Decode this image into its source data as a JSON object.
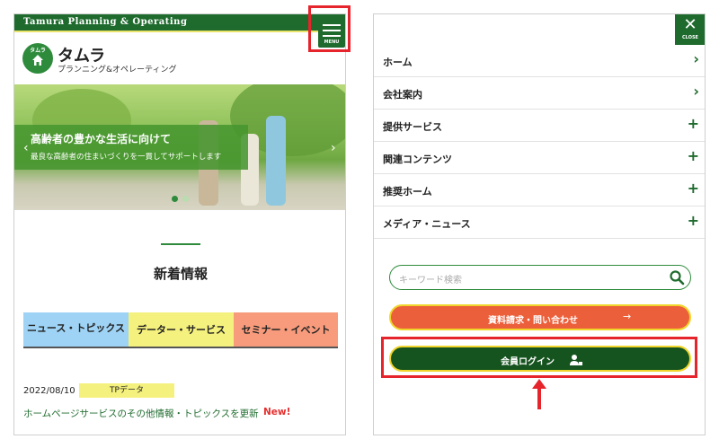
{
  "left_screen": {
    "topbar": {
      "text": "Tamura Planning & Operating"
    },
    "menu_button": {
      "label": "MENU"
    },
    "logo": {
      "mark_text": "タムラ",
      "name": "タムラ",
      "subtitle": "プランニング&オペレーティング"
    },
    "hero": {
      "title": "高齢者の豊かな生活に向けて",
      "subtitle": "最良な高齢者の住まいづくりを一貫してサポートします",
      "prev_icon": "‹",
      "next_icon": "›",
      "active_slide": 1,
      "slide_count": 2
    },
    "news": {
      "title": "新着情報",
      "categories": [
        {
          "label": "ニュース・トピックス",
          "color": "#9ed3f5"
        },
        {
          "label": "データー・サービス",
          "color": "#f5f17e"
        },
        {
          "label": "セミナー・イベント",
          "color": "#f79b7c"
        }
      ],
      "items": [
        {
          "date": "2022/08/10",
          "tag": "TPデータ",
          "text": "ホームページサービスのその他情報・トピックスを更新",
          "badge": "New!"
        }
      ]
    }
  },
  "right_screen": {
    "close_button": {
      "icon": "✕",
      "label": "CLOSE"
    },
    "nav": [
      {
        "label": "ホーム",
        "indicator": "›"
      },
      {
        "label": "会社案内",
        "indicator": "›"
      },
      {
        "label": "提供サービス",
        "indicator": "+"
      },
      {
        "label": "関連コンテンツ",
        "indicator": "+"
      },
      {
        "label": "推奨ホーム",
        "indicator": "+"
      },
      {
        "label": "メディア・ニュース",
        "indicator": "+"
      }
    ],
    "search": {
      "placeholder": "キーワード検索"
    },
    "request_button": {
      "label": "資料請求・問い合わせ",
      "arrow": "→"
    },
    "login_button": {
      "label": "会員ログイン"
    }
  },
  "colors": {
    "brand_green": "#1f6b2e",
    "highlight_red": "#e5242c",
    "request_orange": "#ec5f3b",
    "border_yellow": "#f0d52a"
  }
}
